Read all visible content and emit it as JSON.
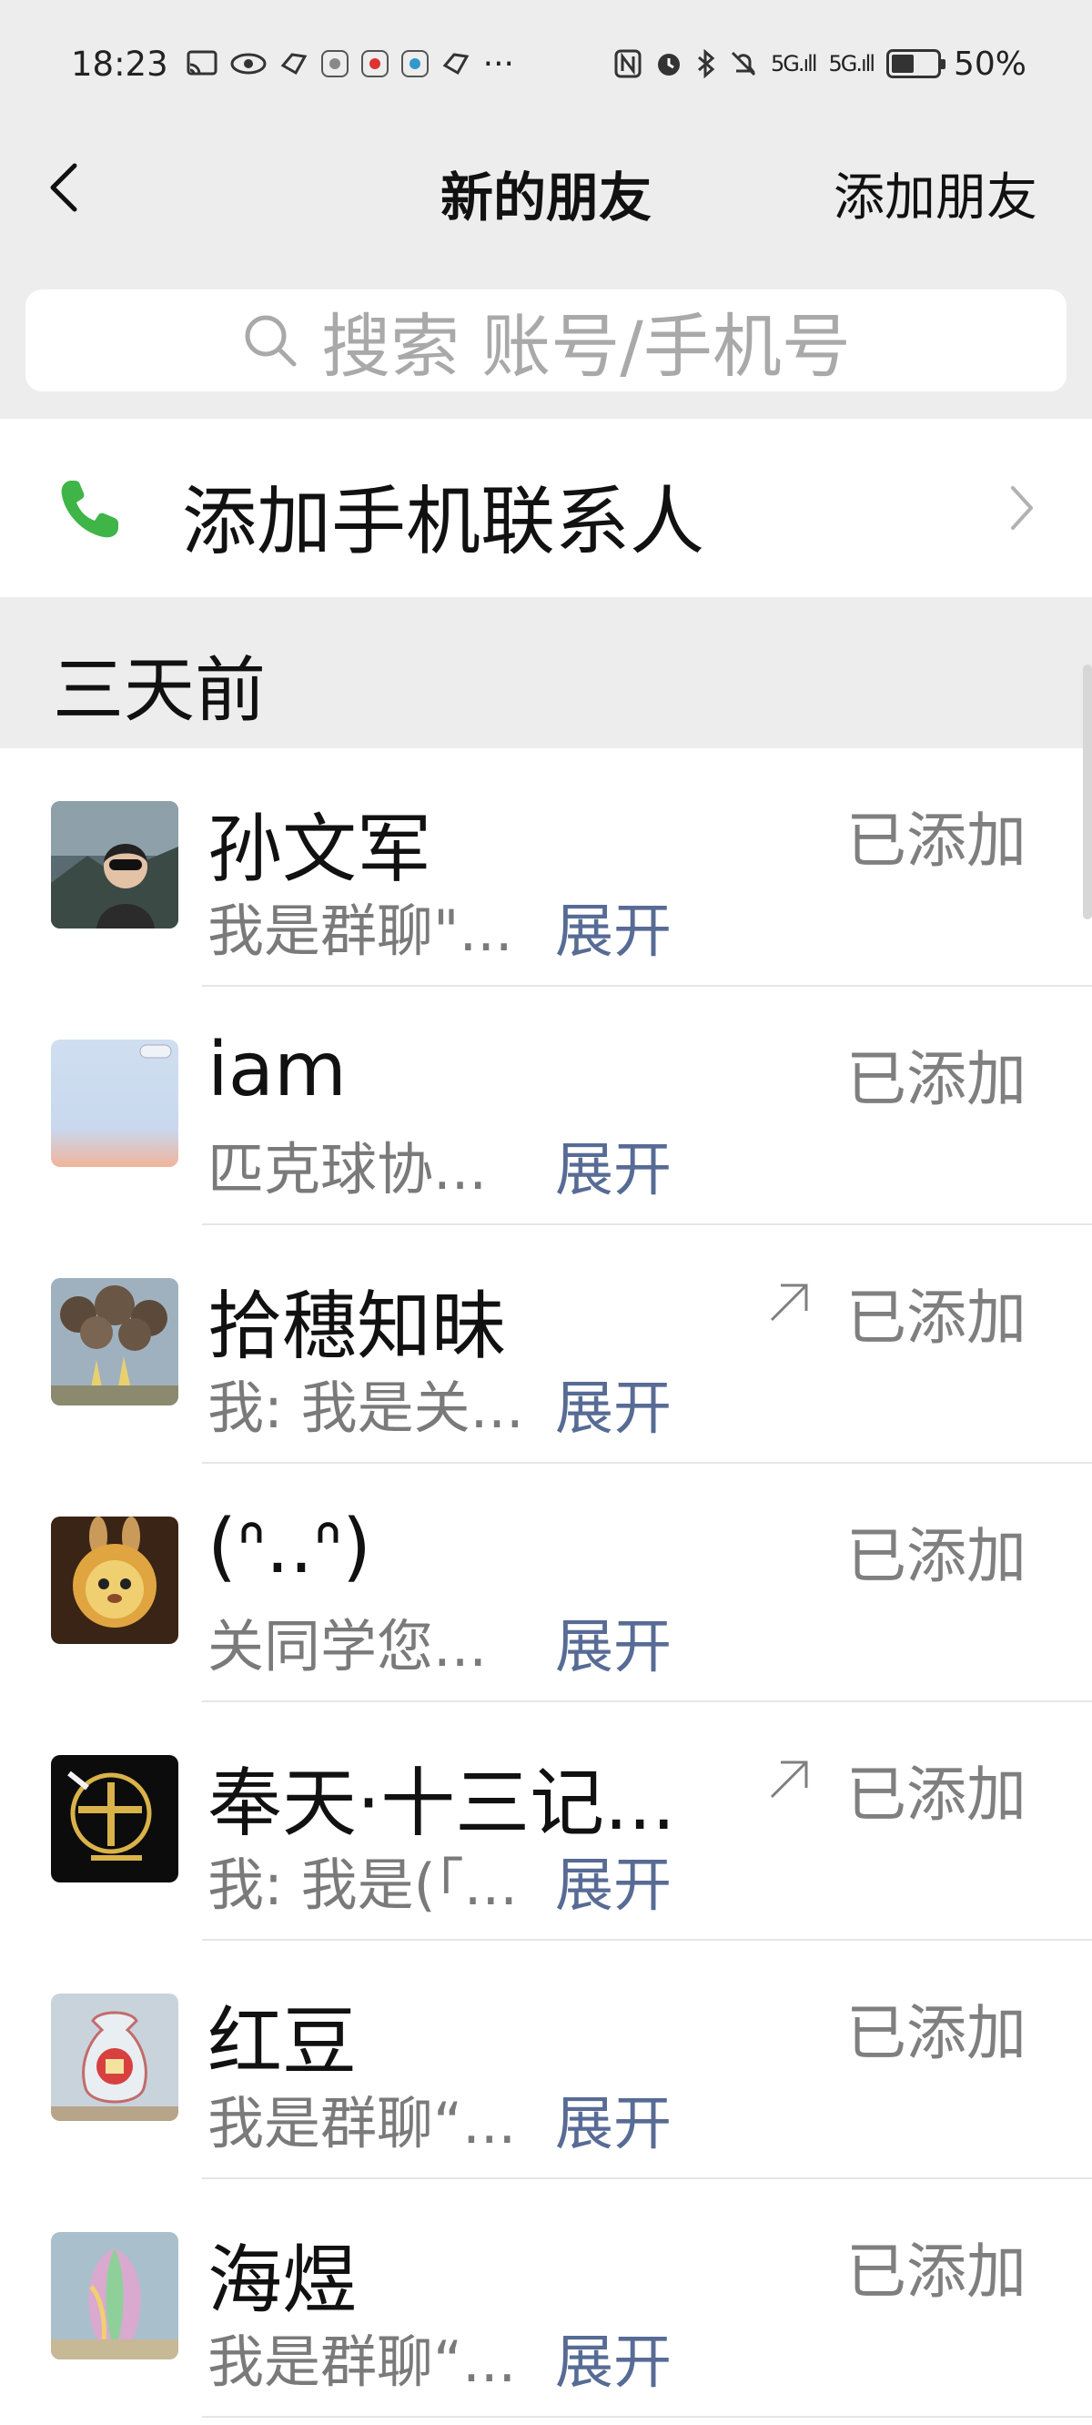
{
  "status_bar": {
    "time": "18:23",
    "icons_left": [
      "cast-icon",
      "eye-icon",
      "app-icon",
      "app-icon",
      "app-icon",
      "app-icon",
      "app-icon",
      "more-icon"
    ],
    "more": "···",
    "nfc": "N",
    "sig1": "5G.ıll",
    "sig2": "5G.ıll",
    "battery": "50%",
    "battery_level": 0.5
  },
  "nav": {
    "title": "新的朋友",
    "action": "添加朋友"
  },
  "search": {
    "placeholder": "搜索 账号/手机号"
  },
  "add_phone": {
    "label": "添加手机联系人"
  },
  "section": {
    "title": "三天前"
  },
  "requests": [
    {
      "name": "孙文军",
      "message": "我是群聊\"...",
      "expand": "展开",
      "status": "已添加",
      "outgoing": false,
      "avatar": "photo-person"
    },
    {
      "name": "iam",
      "message": "匹克球协...",
      "expand": "展开",
      "status": "已添加",
      "outgoing": false,
      "avatar": "photo-pastel"
    },
    {
      "name": "拾穗知昧",
      "message": "我: 我是关...",
      "expand": "展开",
      "status": "已添加",
      "outgoing": true,
      "avatar": "photo-bears"
    },
    {
      "name": "(ᐢ..ᐢ)",
      "message": "关同学您...",
      "expand": "展开",
      "status": "已添加",
      "outgoing": false,
      "avatar": "photo-bunny"
    },
    {
      "name": "奉天·十三记...",
      "message": "我: 我是(「...",
      "expand": "展开",
      "status": "已添加",
      "outgoing": true,
      "avatar": "logo-shisanji"
    },
    {
      "name": "红豆",
      "message": "我是群聊“...",
      "expand": "展开",
      "status": "已添加",
      "outgoing": false,
      "avatar": "photo-fu-bag"
    },
    {
      "name": "海煜",
      "message": "我是群聊“...",
      "expand": "展开",
      "status": "已添加",
      "outgoing": false,
      "avatar": "photo-cabbage"
    }
  ],
  "colors": {
    "link": "#576b95",
    "phone_green": "#3fb548",
    "page_bg": "#ededed"
  }
}
